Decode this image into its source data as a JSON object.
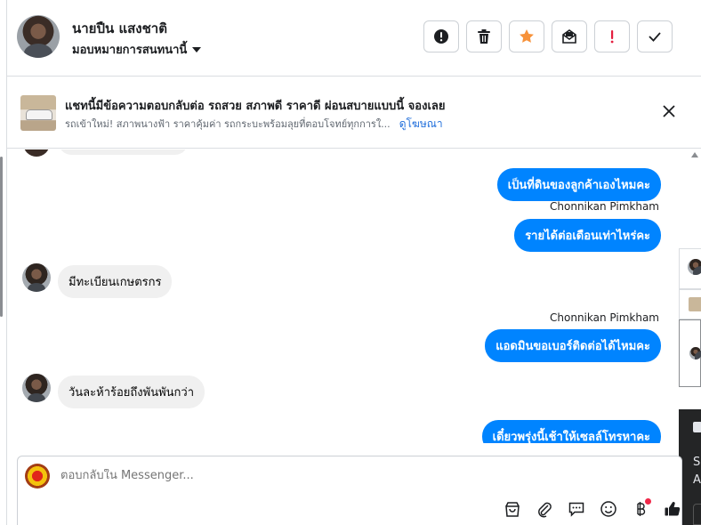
{
  "header": {
    "contact_name": "นายปืน แสงชาติ",
    "assign_label": "มอบหมายการสนทนานี้",
    "actions": [
      {
        "icon": "alert-circle-icon"
      },
      {
        "icon": "trash-icon"
      },
      {
        "icon": "star-icon",
        "color": "#f7923a"
      },
      {
        "icon": "mark-unread-icon"
      },
      {
        "icon": "exclamation-icon",
        "color": "#e41e3f"
      },
      {
        "icon": "check-icon"
      }
    ]
  },
  "ad_banner": {
    "title": "แชทนี้มีข้อความตอบกลับต่อ รถสวย สภาพดี ราคาดี ผ่อนสบายแบบนี้ จองเลย",
    "subtitle": "รถเข้าใหม่! สภาพนางฟ้า ราคาคุ้มค่า รถกระบะพร้อมลุยที่ตอบโจทย์ทุกการใ...",
    "link": "ดูโฆษณา"
  },
  "messages": [
    {
      "direction": "out",
      "text": "เป็นที่ดินของลูกค้าเองไหมคะ"
    },
    {
      "direction": "out",
      "sender": "Chonnikan Pimkham",
      "text": "รายได้ต่อเดือนเท่าไหร่คะ"
    },
    {
      "direction": "in",
      "text": "มีทะเบียนเกษตรกร"
    },
    {
      "direction": "out",
      "sender": "Chonnikan Pimkham",
      "text": "แอดมินขอเบอร์ติดต่อได้ไหมคะ"
    },
    {
      "direction": "in",
      "text": "วันละห้าร้อยถึงพันพันกว่า"
    },
    {
      "direction": "out",
      "text": "เดี๋ยวพรุ่งนี้เช้าให้เซลล์โทรหาคะ"
    }
  ],
  "side_panel": {
    "text_1": "Se",
    "text_2": "A"
  },
  "composer": {
    "placeholder": "ตอบกลับใน Messenger...",
    "tools": [
      "bag-icon",
      "paperclip-icon",
      "saved-reply-icon",
      "emoji-icon",
      "baht-icon",
      "thumbs-up-icon"
    ]
  },
  "colors": {
    "accent": "#0084ff",
    "link": "#216fdb",
    "incoming_bubble": "#f0f0f0"
  }
}
